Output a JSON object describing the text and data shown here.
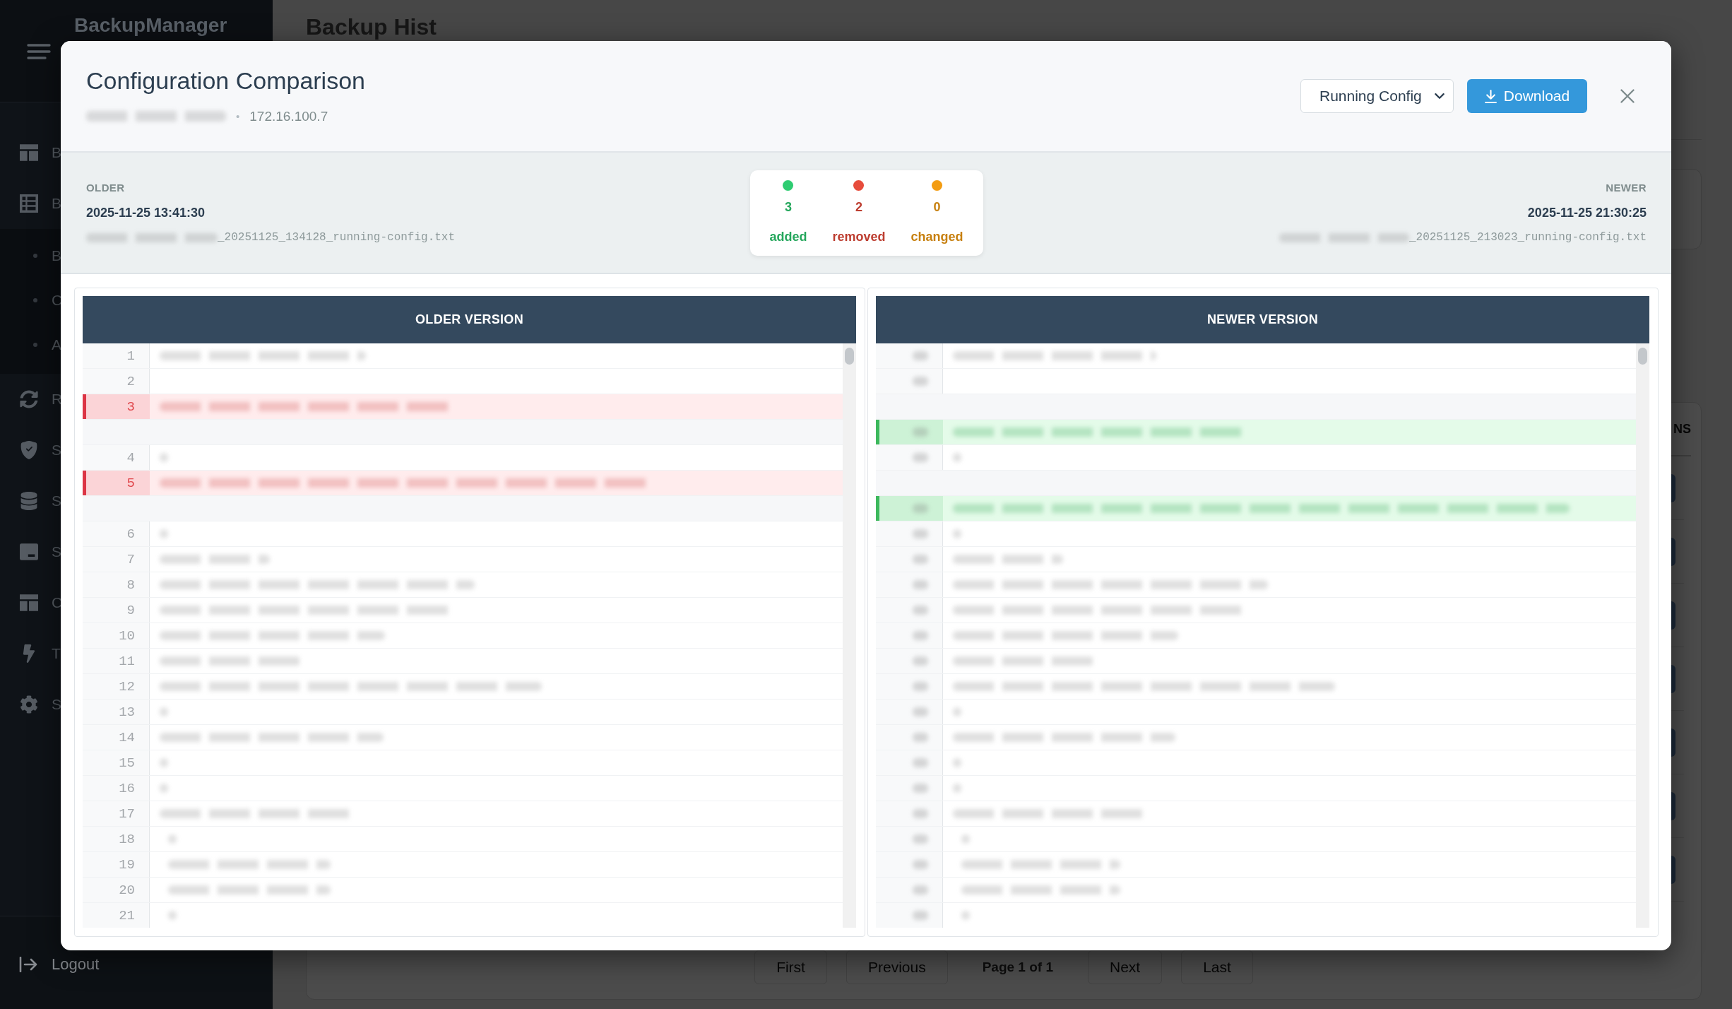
{
  "sidebar": {
    "brand": "BackupManager",
    "items": [
      {
        "label": "B"
      },
      {
        "label": "B",
        "children": [
          {
            "label": "B"
          },
          {
            "label": "C"
          },
          {
            "label": "A"
          }
        ]
      },
      {
        "label": "R"
      },
      {
        "label": "S"
      },
      {
        "label": "S"
      },
      {
        "label": "S"
      },
      {
        "label": "C"
      },
      {
        "label": "T"
      },
      {
        "label": "S"
      }
    ],
    "logout": "Logout"
  },
  "page": {
    "title": "Backup Hist",
    "table": {
      "columns": [
        {
          "header": "NS"
        }
      ],
      "rows": [
        {
          "action_button": true
        },
        {
          "action_button": true
        },
        {
          "action_button": true
        },
        {
          "action_button": true
        },
        {
          "action_button": true
        },
        {
          "action_button": true
        },
        {
          "action_button": true
        }
      ]
    },
    "pagination": [
      {
        "kind": "button",
        "label": "First"
      },
      {
        "kind": "button",
        "label": "Previous"
      },
      {
        "kind": "status",
        "label": "Page 1 of 1"
      },
      {
        "kind": "button",
        "label": "Next"
      },
      {
        "kind": "button",
        "label": "Last"
      }
    ]
  },
  "modal": {
    "title": "Configuration Comparison",
    "subtitle": {
      "separator": "•",
      "ip": "172.16.100.7"
    },
    "config_select": {
      "value": "Running Config"
    },
    "download_button": {
      "label": "Download"
    },
    "older": {
      "label": "OLDER",
      "timestamp": "2025-11-25 13:41:30",
      "filename": "_20251125_134128_running-config.txt"
    },
    "stats": [
      {
        "count": "3",
        "label": "added",
        "color": "#2ecc71"
      },
      {
        "count": "2",
        "label": "removed",
        "color": "#e74c3c"
      },
      {
        "count": "0",
        "label": "changed",
        "color": "#f39c12"
      }
    ],
    "newer": {
      "label": "NEWER",
      "timestamp": "2025-11-25 21:30:25",
      "filename": "_20251125_213023_running-config.txt"
    },
    "panes": [
      {
        "title": "OLDER VERSION",
        "lines": [
          {
            "number": "1",
            "kind": "same"
          },
          {
            "number": "2",
            "kind": "same"
          },
          {
            "number": "3",
            "kind": "removed"
          },
          {
            "kind": "spacer"
          },
          {
            "number": "4",
            "kind": "same"
          },
          {
            "number": "5",
            "kind": "removed"
          },
          {
            "kind": "spacer"
          },
          {
            "number": "6",
            "kind": "same"
          },
          {
            "number": "7",
            "kind": "same"
          },
          {
            "number": "8",
            "kind": "same"
          },
          {
            "number": "9",
            "kind": "same"
          },
          {
            "number": "10",
            "kind": "same"
          },
          {
            "number": "11",
            "kind": "same"
          },
          {
            "number": "12",
            "kind": "same"
          },
          {
            "number": "13",
            "kind": "same"
          },
          {
            "number": "14",
            "kind": "same"
          },
          {
            "number": "15",
            "kind": "same"
          },
          {
            "number": "16",
            "kind": "same"
          },
          {
            "number": "17",
            "kind": "same"
          },
          {
            "number": "18",
            "kind": "same"
          },
          {
            "number": "19",
            "kind": "same"
          },
          {
            "number": "20",
            "kind": "same"
          },
          {
            "number": "21",
            "kind": "same"
          }
        ]
      },
      {
        "title": "NEWER VERSION",
        "lines": [
          {
            "kind": "same"
          },
          {
            "kind": "same"
          },
          {
            "kind": "spacer"
          },
          {
            "kind": "added"
          },
          {
            "kind": "same"
          },
          {
            "kind": "spacer"
          },
          {
            "kind": "added"
          },
          {
            "kind": "same"
          },
          {
            "kind": "same"
          },
          {
            "kind": "same"
          },
          {
            "kind": "same"
          },
          {
            "kind": "same"
          },
          {
            "kind": "same"
          },
          {
            "kind": "same"
          },
          {
            "kind": "same"
          },
          {
            "kind": "same"
          },
          {
            "kind": "same"
          },
          {
            "kind": "same"
          },
          {
            "kind": "same"
          },
          {
            "kind": "same"
          },
          {
            "kind": "same"
          },
          {
            "kind": "same"
          },
          {
            "kind": "same"
          }
        ]
      }
    ]
  }
}
